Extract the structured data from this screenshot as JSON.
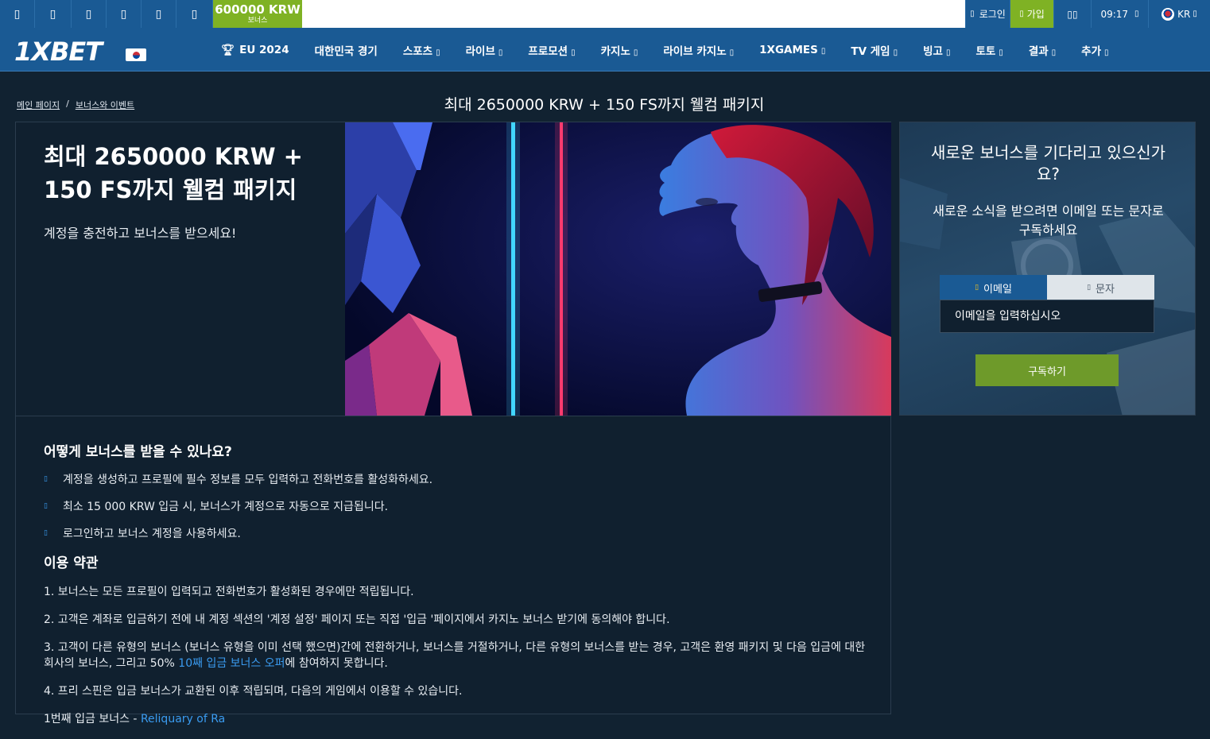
{
  "topbar": {
    "left_icons": [
      "mobile-icon",
      "tablet-icon",
      "apple-icon",
      "android-icon",
      "windows-icon",
      "chat-icon"
    ],
    "bonus_amount": "600000 KRW",
    "bonus_label": "보너스",
    "login_label": "로그인",
    "register_label": "가입",
    "time": "09:17",
    "language": "KR"
  },
  "nav": {
    "logo": "1XBET",
    "items": [
      {
        "label": "EU 2024"
      },
      {
        "label": "대한민국 경기"
      },
      {
        "label": "스포츠"
      },
      {
        "label": "라이브"
      },
      {
        "label": "프로모션"
      },
      {
        "label": "카지노"
      },
      {
        "label": "라이브 카지노"
      },
      {
        "label": "1XGAMES"
      },
      {
        "label": "TV 게임"
      },
      {
        "label": "빙고"
      },
      {
        "label": "토토"
      },
      {
        "label": "결과"
      },
      {
        "label": "추가"
      }
    ]
  },
  "breadcrumb": {
    "home": "메인 페이지",
    "separator": "/",
    "section": "보너스와 이벤트"
  },
  "page_title": "최대 2650000 KRW + 150 FS까지 웰컴 패키지",
  "promo": {
    "heading_line1": "최대 2650000 KRW +",
    "heading_line2": "150 FS까지 웰컴 패키지",
    "subtitle": "계정을 충전하고 보너스를 받으세요!"
  },
  "how_to": {
    "title": "어떻게 보너스를 받을 수 있나요?",
    "steps": [
      "계정을 생성하고 프로필에 필수 정보를 모두 입력하고 전화번호를 활성화하세요.",
      "최소 15 000 KRW 입금 시, 보너스가 계정으로 자동으로 지급됩니다.",
      "로그인하고 보너스 계정을 사용하세요."
    ]
  },
  "terms": {
    "title": "이용 약관",
    "items": [
      "1. 보너스는 모든 프로필이 입력되고 전화번호가 활성화된 경우에만 적립됩니다.",
      "2. 고객은 계좌로 입금하기 전에 내 계정 섹션의 '계정 설정' 페이지 또는 직접 '입금 '페이지에서 카지노 보너스 받기에 동의해야 합니다.",
      "3. 고객이 다른 유형의 보너스 (보너스 유형을 이미 선택 했으면)간에 전환하거나, 보너스를 거절하거나, 다른 유형의 보너스를 받는 경우, 고객은 환영 패키지 및 다음 입금에 대한 회사의 보너스, 그리고 50%",
      "4. 프리 스핀은 입금 보너스가 교환된 이후 적립되며, 다음의 게임에서 이용할 수 있습니다.",
      "1번째 입금 보너스 -"
    ],
    "item3_link": "10째 입금 보너스 오퍼",
    "item3_tail": "에 참여하지 못합니다.",
    "item5_link": "Reliquary of Ra"
  },
  "subscribe": {
    "title": "새로운 보너스를 기다리고 있으신가요?",
    "description": "새로운 소식을 받으려면 이메일 또는 문자로 구독하세요",
    "tab_email": "이메일",
    "tab_sms": "문자",
    "email_placeholder": "이메일을 입력하십시오",
    "button": "구독하기"
  },
  "colors": {
    "brand_blue": "#1a5a94",
    "accent_green": "#7fb224",
    "background": "#112231",
    "link": "#3a9bf0"
  }
}
